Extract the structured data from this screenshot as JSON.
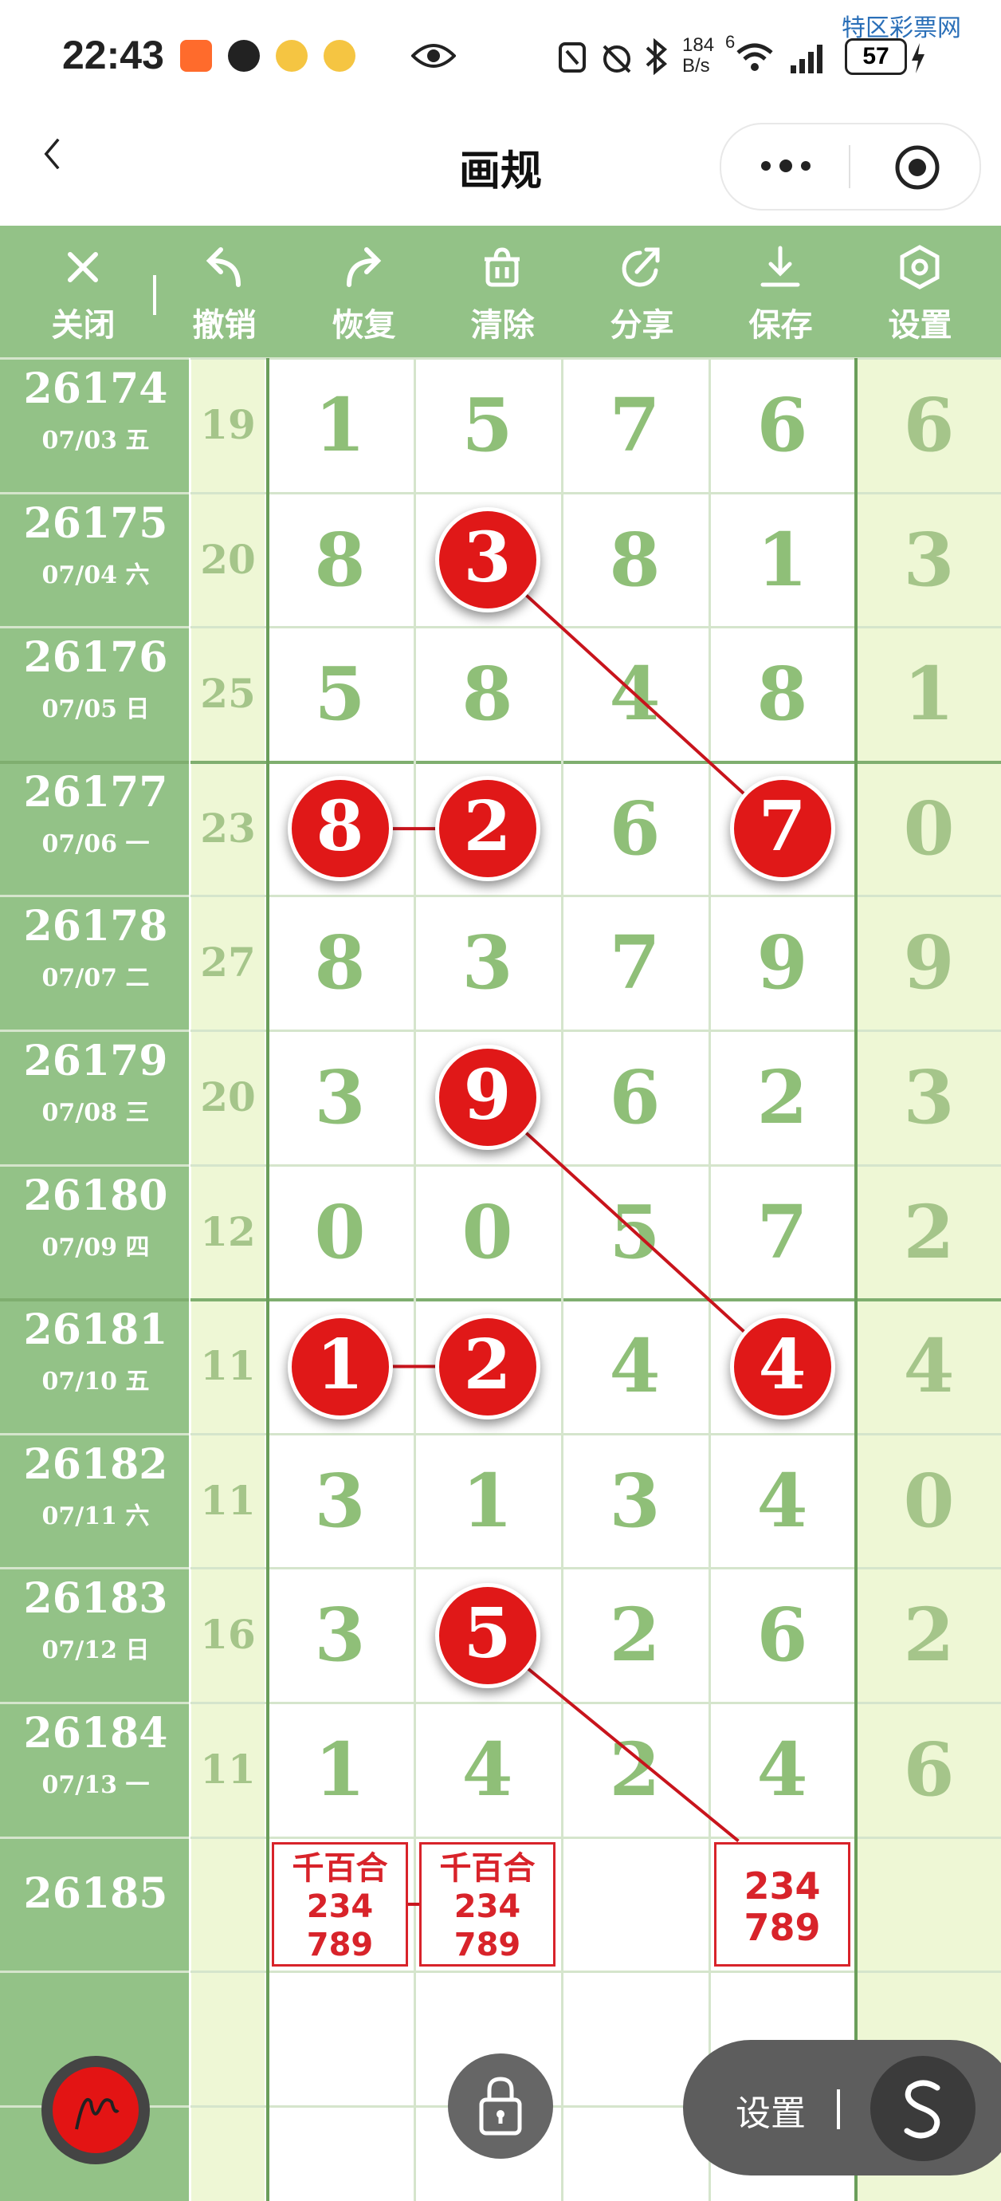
{
  "status_bar": {
    "time": "22:43",
    "net_speed_top": "184",
    "net_speed_bottom": "B/s",
    "signal_extra": "6",
    "battery": "57"
  },
  "watermark": {
    "text": "特区彩票网",
    "url": "tqcp.net"
  },
  "nav": {
    "title": "画规"
  },
  "toolbar": [
    {
      "label": "关闭",
      "icon": "close-icon"
    },
    {
      "label": "撤销",
      "icon": "undo-icon"
    },
    {
      "label": "恢复",
      "icon": "redo-icon"
    },
    {
      "label": "清除",
      "icon": "trash-icon"
    },
    {
      "label": "分享",
      "icon": "share-icon"
    },
    {
      "label": "保存",
      "icon": "download-icon"
    },
    {
      "label": "设置",
      "icon": "settings-icon"
    }
  ],
  "rows": [
    {
      "issue": "26174",
      "date": "07/03 五",
      "sum": "19",
      "digits": [
        "1",
        "5",
        "7",
        "6"
      ],
      "last": "6"
    },
    {
      "issue": "26175",
      "date": "07/04 六",
      "sum": "20",
      "digits": [
        "8",
        "3",
        "8",
        "1"
      ],
      "last": "3"
    },
    {
      "issue": "26176",
      "date": "07/05 日",
      "sum": "25",
      "digits": [
        "5",
        "8",
        "4",
        "8"
      ],
      "last": "1"
    },
    {
      "issue": "26177",
      "date": "07/06 一",
      "sum": "23",
      "digits": [
        "8",
        "2",
        "6",
        "7"
      ],
      "last": "0"
    },
    {
      "issue": "26178",
      "date": "07/07 二",
      "sum": "27",
      "digits": [
        "8",
        "3",
        "7",
        "9"
      ],
      "last": "9"
    },
    {
      "issue": "26179",
      "date": "07/08 三",
      "sum": "20",
      "digits": [
        "3",
        "9",
        "6",
        "2"
      ],
      "last": "3"
    },
    {
      "issue": "26180",
      "date": "07/09 四",
      "sum": "12",
      "digits": [
        "0",
        "0",
        "5",
        "7"
      ],
      "last": "2"
    },
    {
      "issue": "26181",
      "date": "07/10 五",
      "sum": "11",
      "digits": [
        "1",
        "2",
        "4",
        "4"
      ],
      "last": "4"
    },
    {
      "issue": "26182",
      "date": "07/11 六",
      "sum": "11",
      "digits": [
        "3",
        "1",
        "3",
        "4"
      ],
      "last": "0"
    },
    {
      "issue": "26183",
      "date": "07/12 日",
      "sum": "16",
      "digits": [
        "3",
        "5",
        "2",
        "6"
      ],
      "last": "2"
    },
    {
      "issue": "26184",
      "date": "07/13 一",
      "sum": "11",
      "digits": [
        "1",
        "4",
        "2",
        "4"
      ],
      "last": "6"
    }
  ],
  "highlights": [
    {
      "row": 1,
      "col": 1
    },
    {
      "row": 3,
      "col": 0
    },
    {
      "row": 3,
      "col": 1
    },
    {
      "row": 3,
      "col": 3
    },
    {
      "row": 5,
      "col": 1
    },
    {
      "row": 7,
      "col": 0
    },
    {
      "row": 7,
      "col": 1
    },
    {
      "row": 7,
      "col": 3
    },
    {
      "row": 9,
      "col": 1
    }
  ],
  "next_issue": {
    "issue": "26185",
    "predictions": [
      {
        "col": 0,
        "lines": [
          "千百合",
          "234",
          "789"
        ]
      },
      {
        "col": 1,
        "lines": [
          "千百合",
          "234",
          "789"
        ]
      },
      {
        "col": 3,
        "lines": [
          "234",
          "789"
        ]
      }
    ]
  },
  "floating": {
    "settings_label": "设置"
  },
  "colors": {
    "header_green": "#93c287",
    "ball_red": "#e01818",
    "digit_green": "#8fbf78",
    "sum_bg": "#eef7d5",
    "line_red": "#c8141c"
  }
}
